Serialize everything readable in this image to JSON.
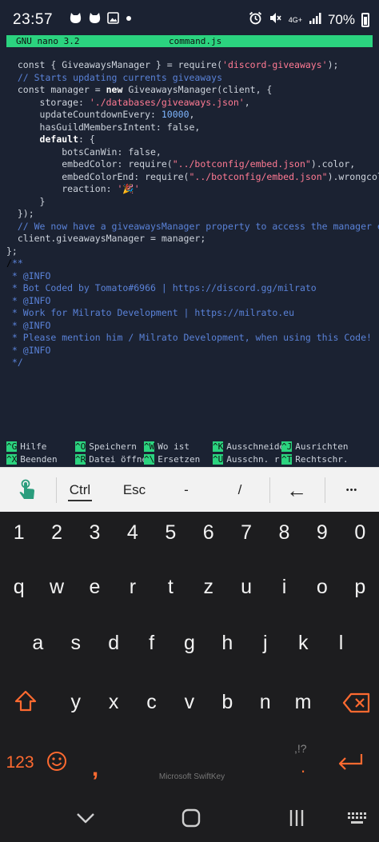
{
  "status_bar": {
    "time": "23:57",
    "network_label": "4G+",
    "battery_percent": "70%"
  },
  "nano": {
    "version": "GNU nano 3.2",
    "filename": "command.js"
  },
  "code_lines": [
    [
      {
        "t": "  const { GiveawaysManager } = require(",
        "c": "def"
      },
      {
        "t": "'discord-giveaways'",
        "c": "str"
      },
      {
        "t": ");",
        "c": "def"
      }
    ],
    [
      {
        "t": "  // Starts updating currents giveaways",
        "c": "com"
      }
    ],
    [
      {
        "t": "  const manager = ",
        "c": "def"
      },
      {
        "t": "new",
        "c": "kw"
      },
      {
        "t": " GiveawaysManager(client, {",
        "c": "def"
      }
    ],
    [
      {
        "t": "      storage: ",
        "c": "def"
      },
      {
        "t": "'./databases/giveaways.json'",
        "c": "str"
      },
      {
        "t": ",",
        "c": "def"
      }
    ],
    [
      {
        "t": "      updateCountdownEvery: ",
        "c": "def"
      },
      {
        "t": "10000",
        "c": "num"
      },
      {
        "t": ",",
        "c": "def"
      }
    ],
    [
      {
        "t": "      hasGuildMembersIntent: false,",
        "c": "def"
      }
    ],
    [
      {
        "t": "      ",
        "c": "def"
      },
      {
        "t": "default",
        "c": "kw"
      },
      {
        "t": ": {",
        "c": "def"
      }
    ],
    [
      {
        "t": "          botsCanWin: false,",
        "c": "def"
      }
    ],
    [
      {
        "t": "          embedColor: require(",
        "c": "def"
      },
      {
        "t": "\"../botconfig/embed.json\"",
        "c": "str"
      },
      {
        "t": ").color,",
        "c": "def"
      }
    ],
    [
      {
        "t": "          embedColorEnd: require(",
        "c": "def"
      },
      {
        "t": "\"../botconfig/embed.json\"",
        "c": "str"
      },
      {
        "t": ").wrongcolor,",
        "c": "def"
      }
    ],
    [
      {
        "t": "          reaction: ",
        "c": "def"
      },
      {
        "t": "'🎉'",
        "c": "str"
      }
    ],
    [
      {
        "t": "      }",
        "c": "def"
      }
    ],
    [
      {
        "t": "  });",
        "c": "def"
      }
    ],
    [
      {
        "t": "  // We now have a giveawaysManager property to access the manager everyw$",
        "c": "com"
      }
    ],
    [
      {
        "t": "  client.giveawaysManager = manager;",
        "c": "def"
      }
    ],
    [
      {
        "t": "};",
        "c": "def"
      }
    ],
    [
      {
        "t": "/",
        "c": "cursor"
      },
      {
        "t": "**",
        "c": "com"
      }
    ],
    [
      {
        "t": " * @INFO",
        "c": "com"
      }
    ],
    [
      {
        "t": " * Bot Coded by Tomato#6966 | https://discord.gg/milrato",
        "c": "com"
      }
    ],
    [
      {
        "t": " * @INFO",
        "c": "com"
      }
    ],
    [
      {
        "t": " * Work for Milrato Development | https://milrato.eu",
        "c": "com"
      }
    ],
    [
      {
        "t": " * @INFO",
        "c": "com"
      }
    ],
    [
      {
        "t": " * Please mention him / Milrato Development, when using this Code!",
        "c": "com"
      }
    ],
    [
      {
        "t": " * @INFO",
        "c": "com"
      }
    ],
    [
      {
        "t": " */",
        "c": "com"
      }
    ]
  ],
  "shortcuts": [
    [
      {
        "key": "^G",
        "label": "Hilfe"
      },
      {
        "key": "^O",
        "label": "Speichern"
      },
      {
        "key": "^W",
        "label": "Wo ist"
      },
      {
        "key": "^K",
        "label": "Ausschneide"
      },
      {
        "key": "^J",
        "label": "Ausrichten"
      }
    ],
    [
      {
        "key": "^X",
        "label": "Beenden"
      },
      {
        "key": "^R",
        "label": "Datei öffne"
      },
      {
        "key": "^\\",
        "label": "Ersetzen"
      },
      {
        "key": "^U",
        "label": "Ausschn. r"
      },
      {
        "key": "^T",
        "label": "Rechtschr."
      }
    ]
  ],
  "toolbar": {
    "ctrl_label": "Ctrl",
    "esc_label": "Esc",
    "dash_label": "-",
    "slash_label": "/",
    "back_arrow": "←",
    "more_label": "•••"
  },
  "keyboard": {
    "number_row": [
      "1",
      "2",
      "3",
      "4",
      "5",
      "6",
      "7",
      "8",
      "9",
      "0"
    ],
    "row1": [
      "q",
      "w",
      "e",
      "r",
      "t",
      "z",
      "u",
      "i",
      "o",
      "p"
    ],
    "row2": [
      "a",
      "s",
      "d",
      "f",
      "g",
      "h",
      "j",
      "k",
      "l"
    ],
    "row3": [
      "y",
      "x",
      "c",
      "v",
      "b",
      "n",
      "m"
    ],
    "symbols_label": "123",
    "comma_label": ",",
    "period_label": ".",
    "punct_hint": ",!?",
    "brand": "Microsoft SwiftKey"
  },
  "colors": {
    "nano_accent": "#2bd37f",
    "terminal_bg": "#1b2232",
    "string": "#ff7a93",
    "comment": "#5a82d8",
    "number": "#7fb6ff",
    "keyboard_accent": "#ff6a30"
  }
}
